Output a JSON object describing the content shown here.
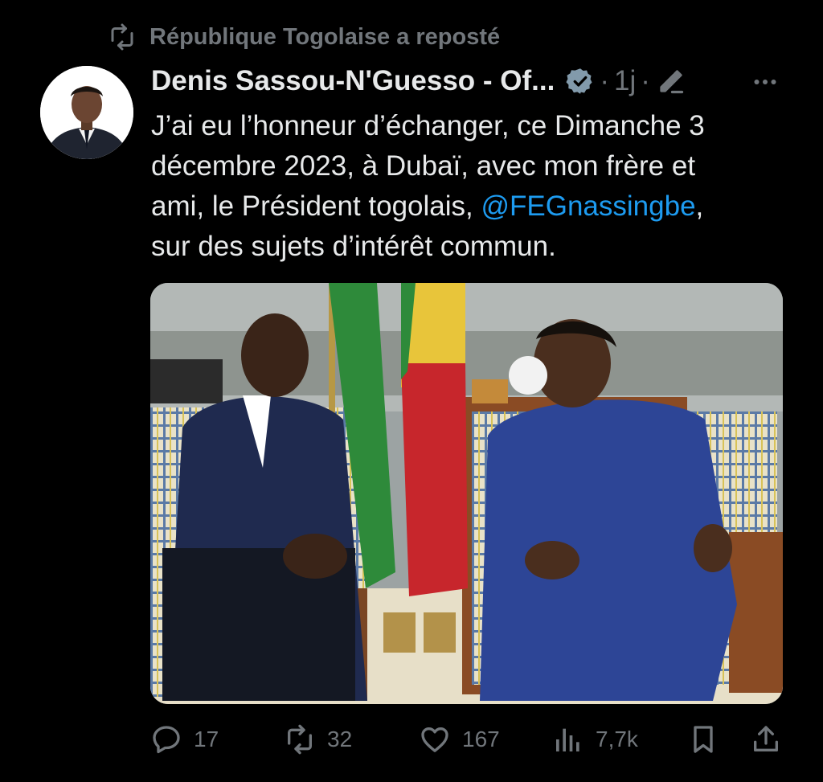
{
  "repost_banner": {
    "text": "République Togolaise a reposté",
    "icon": "repost-icon"
  },
  "tweet": {
    "author": "Denis Sassou-N'Guesso - Of...",
    "verified_icon": "verified-badge-icon",
    "meta_sep": "·",
    "time": "1j",
    "edit_icon": "edit-icon",
    "more_icon": "more-icon",
    "text": {
      "line1": "J’ai eu l’honneur d’échanger, ce Dimanche 3",
      "line2": "décembre 2023, à Dubaï, avec mon frère et",
      "line3_a": "ami, le Président togolais, ",
      "mention": "@FEGnassingbe",
      "line3_b": ",",
      "line4": "sur des sujets d’intérêt commun."
    },
    "media": {
      "type": "photo"
    }
  },
  "actions": {
    "replies": "17",
    "reposts": "32",
    "likes": "167",
    "views": "7,7k",
    "bookmark_icon": "bookmark-icon",
    "share_icon": "share-icon"
  },
  "colors": {
    "background": "#000000",
    "text": "#e7e9ea",
    "muted": "#71767b",
    "accent": "#1d9bf0"
  }
}
